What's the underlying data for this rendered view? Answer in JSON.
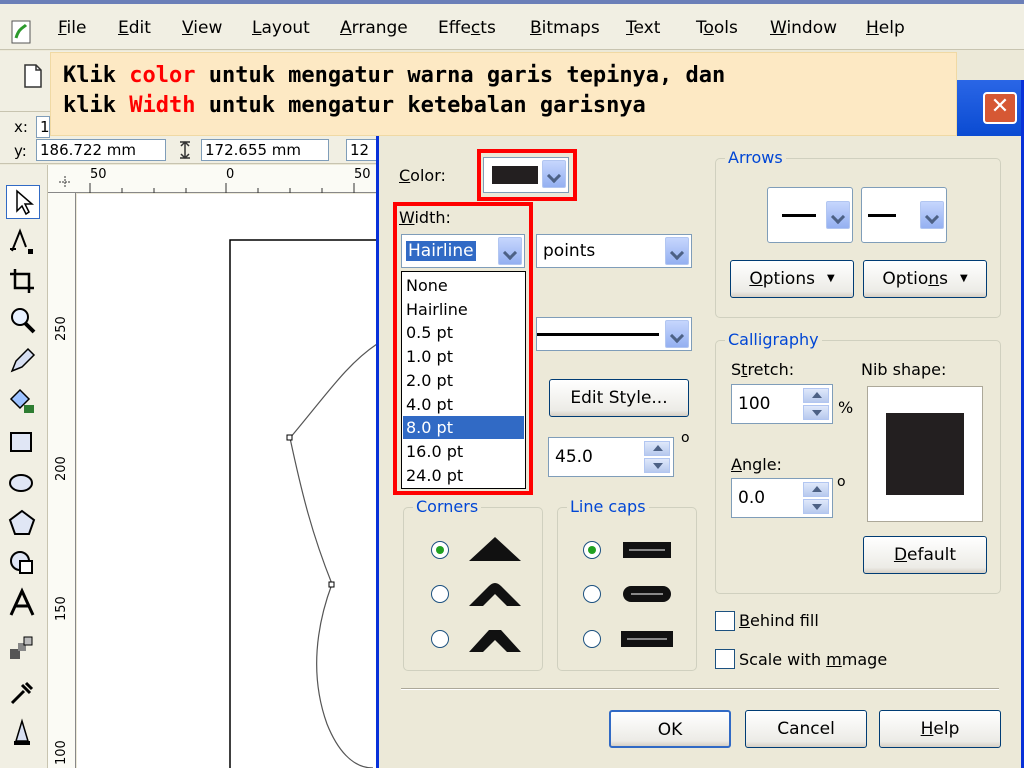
{
  "menu": {
    "items": [
      {
        "pre": "",
        "key": "F",
        "post": "ile"
      },
      {
        "pre": "",
        "key": "E",
        "post": "dit"
      },
      {
        "pre": "",
        "key": "V",
        "post": "iew"
      },
      {
        "pre": "",
        "key": "L",
        "post": "ayout"
      },
      {
        "pre": "",
        "key": "A",
        "post": "rrange"
      },
      {
        "pre": "Effe",
        "key": "c",
        "post": "ts"
      },
      {
        "pre": "",
        "key": "B",
        "post": "itmaps"
      },
      {
        "pre": "",
        "key": "T",
        "post": "ext"
      },
      {
        "pre": "T",
        "key": "o",
        "post": "ols"
      },
      {
        "pre": "",
        "key": "W",
        "post": "indow"
      },
      {
        "pre": "",
        "key": "H",
        "post": "elp"
      }
    ]
  },
  "propbar": {
    "x_label": "x:",
    "x_value": "1",
    "y_label": "y:",
    "y_value": "186.722 mm",
    "height_value": "172.655 mm",
    "extra_value": "12"
  },
  "ruler": {
    "h_ticks": [
      "50",
      "0",
      "50"
    ],
    "v_ticks": [
      "250",
      "200",
      "150",
      "100"
    ]
  },
  "note": {
    "line1_a": "Klik ",
    "line1_hl": "color",
    "line1_b": " untuk mengatur warna garis tepinya, dan",
    "line2_a": "klik ",
    "line2_hl": "Width",
    "line2_b": " untuk mengatur ketebalan garisnya"
  },
  "dialog": {
    "close_glyph": "✕",
    "color_label": "Color:",
    "width_label": "Width:",
    "width_value": "Hairline",
    "units_value": "points",
    "width_options": [
      "None",
      "Hairline",
      "0.5 pt",
      "1.0 pt",
      "2.0 pt",
      "4.0 pt",
      "8.0 pt",
      "16.0 pt",
      "24.0 pt"
    ],
    "width_selected": "8.0 pt",
    "edit_style_label": "Edit Style...",
    "miter_value": "45.0",
    "degree_symbol": "o",
    "corners_title": "Corners",
    "linecaps_title": "Line caps",
    "arrows_title": "Arrows",
    "options_label_1": "Options",
    "options_label_2": "Options",
    "calligraphy_title": "Calligraphy",
    "stretch_label": "Stretch:",
    "stretch_value": "100",
    "percent_symbol": "%",
    "nib_label": "Nib shape:",
    "angle_label": "Angle:",
    "angle_value": "0.0",
    "default_label": "Default",
    "behind_fill_label": "Behind fill",
    "scale_label": "Scale with image",
    "ok_label": "OK",
    "cancel_label": "Cancel",
    "help_label": "Help"
  },
  "colors": {
    "outline_color": "#231f20",
    "highlight_red": "#ff0000",
    "selection_blue": "#316ac5",
    "group_title_blue": "#0046d5"
  }
}
